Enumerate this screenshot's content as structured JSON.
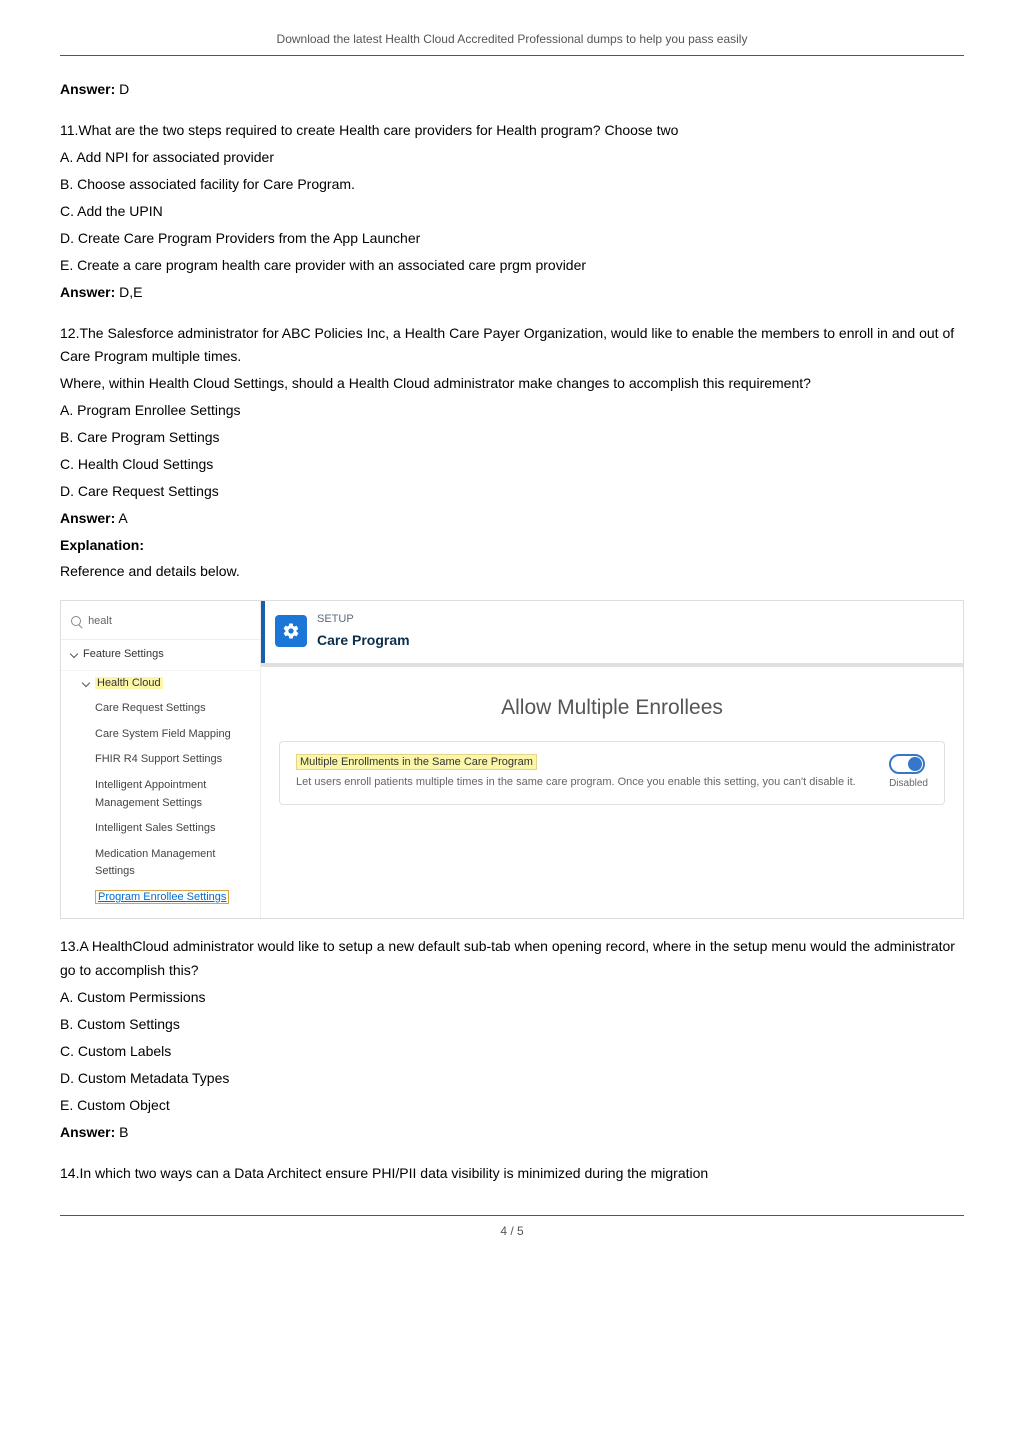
{
  "header": "Download the latest Health Cloud Accredited Professional dumps to help you pass easily",
  "q10_answer_label": "Answer:",
  "q10_answer_value": "D",
  "q11": {
    "prompt": "11.What are the two steps required to create Health care providers for Health program? Choose two",
    "opts": [
      "A. Add NPI for associated provider",
      "B. Choose associated facility for Care Program.",
      "C. Add the UPIN",
      "D. Create Care Program Providers from the App Launcher",
      "E. Create a care program health care provider with an associated care prgm provider"
    ],
    "answer_label": "Answer:",
    "answer_value": "D,E"
  },
  "q12": {
    "prompt_line1": "12.The Salesforce administrator for ABC Policies Inc, a Health Care Payer Organization, would like to enable the members to enroll in and out of Care Program multiple times.",
    "prompt_line2": "Where, within Health Cloud Settings, should a Health Cloud administrator make changes to accomplish this requirement?",
    "opts": [
      "A. Program Enrollee Settings",
      "B. Care Program Settings",
      "C. Health Cloud Settings",
      "D. Care Request Settings"
    ],
    "answer_label": "Answer:",
    "answer_value": "A",
    "explanation_label": "Explanation:",
    "explanation_text": "Reference and details below."
  },
  "screenshot": {
    "search_placeholder": "healt",
    "feature_settings": "Feature Settings",
    "health_cloud": "Health Cloud",
    "sidebar_items": [
      "Care Request Settings",
      "Care System Field Mapping",
      "FHIR R4 Support Settings",
      "Intelligent Appointment Management Settings",
      "Intelligent Sales Settings",
      "Medication Management Settings"
    ],
    "sidebar_active": "Program Enrollee Settings",
    "setup_label": "SETUP",
    "care_program_title": "Care Program",
    "allow_heading": "Allow Multiple Enrollees",
    "enroll_title": "Multiple Enrollments in the Same Care Program",
    "enroll_desc": "Let users enroll patients multiple times in the same care program. Once you enable this setting, you can't disable it.",
    "toggle_state": "Disabled"
  },
  "q13": {
    "prompt": "13.A HealthCloud administrator would like to setup a new default sub-tab when opening record, where in the setup menu would the administrator go to accomplish this?",
    "opts": [
      "A. Custom Permissions",
      "B. Custom Settings",
      "C. Custom Labels",
      "D. Custom Metadata Types",
      "E. Custom Object"
    ],
    "answer_label": "Answer:",
    "answer_value": "B"
  },
  "q14": {
    "prompt": "14.In which two ways can a Data Architect ensure PHI/PII data visibility is minimized during the migration"
  },
  "footer": "4 / 5"
}
